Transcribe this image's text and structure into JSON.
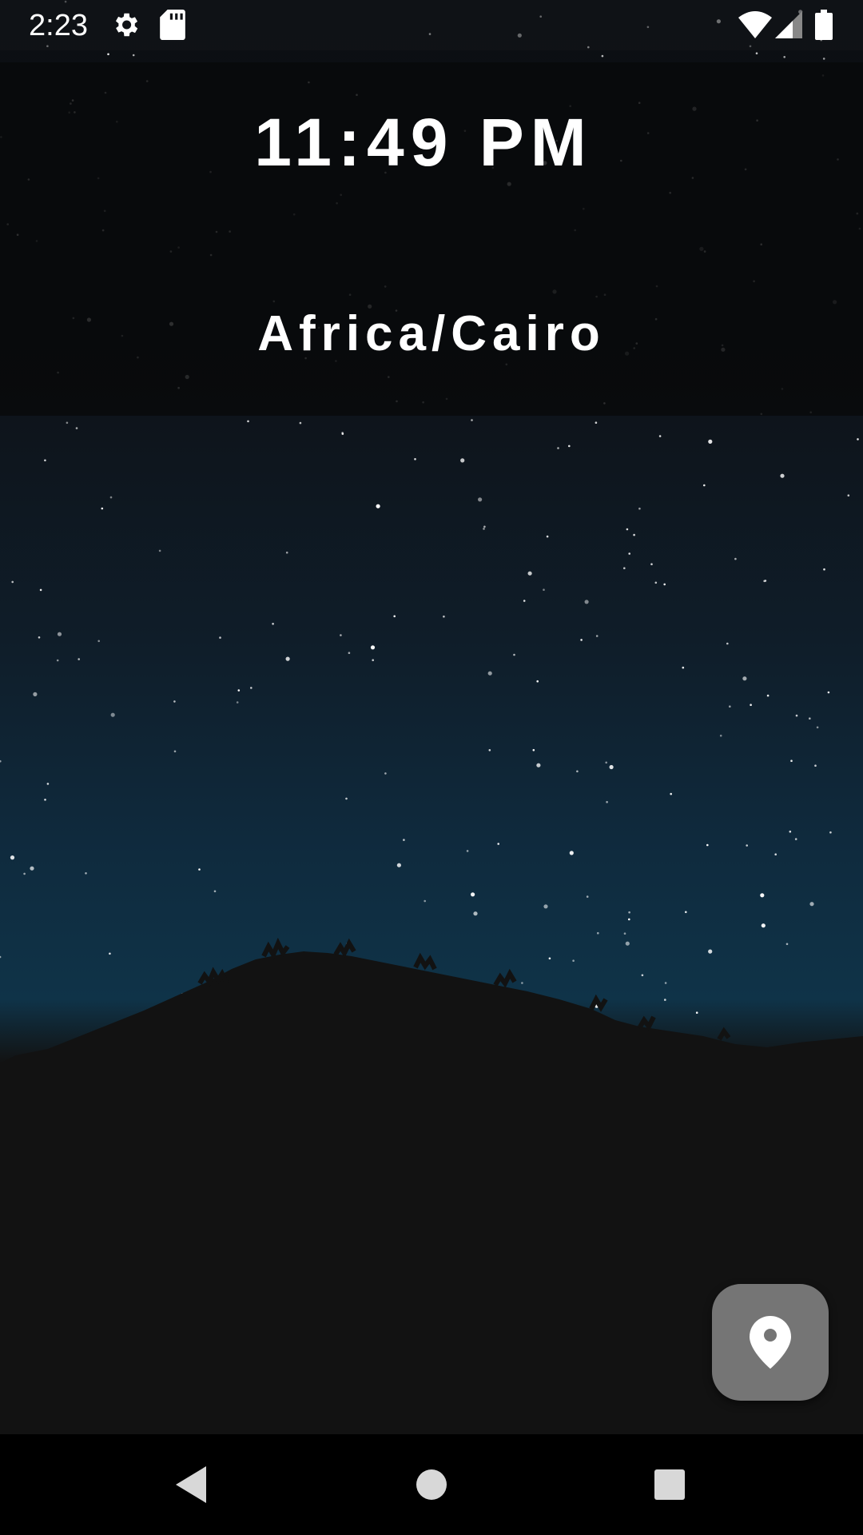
{
  "status_bar": {
    "time": "2:23",
    "icons": [
      "settings-icon",
      "sd-card-icon",
      "wifi-icon",
      "signal-icon",
      "battery-icon"
    ]
  },
  "clock": {
    "time": "11:49 PM",
    "timezone": "Africa/Cairo"
  },
  "fab": {
    "icon": "location-pin-icon",
    "color": "#757575"
  },
  "nav_bar": {
    "buttons": [
      "back-icon",
      "home-icon",
      "recents-icon"
    ]
  },
  "colors": {
    "sky_top": "#0b0e12",
    "sky_bottom": "#0f3348",
    "ground": "#121212"
  }
}
